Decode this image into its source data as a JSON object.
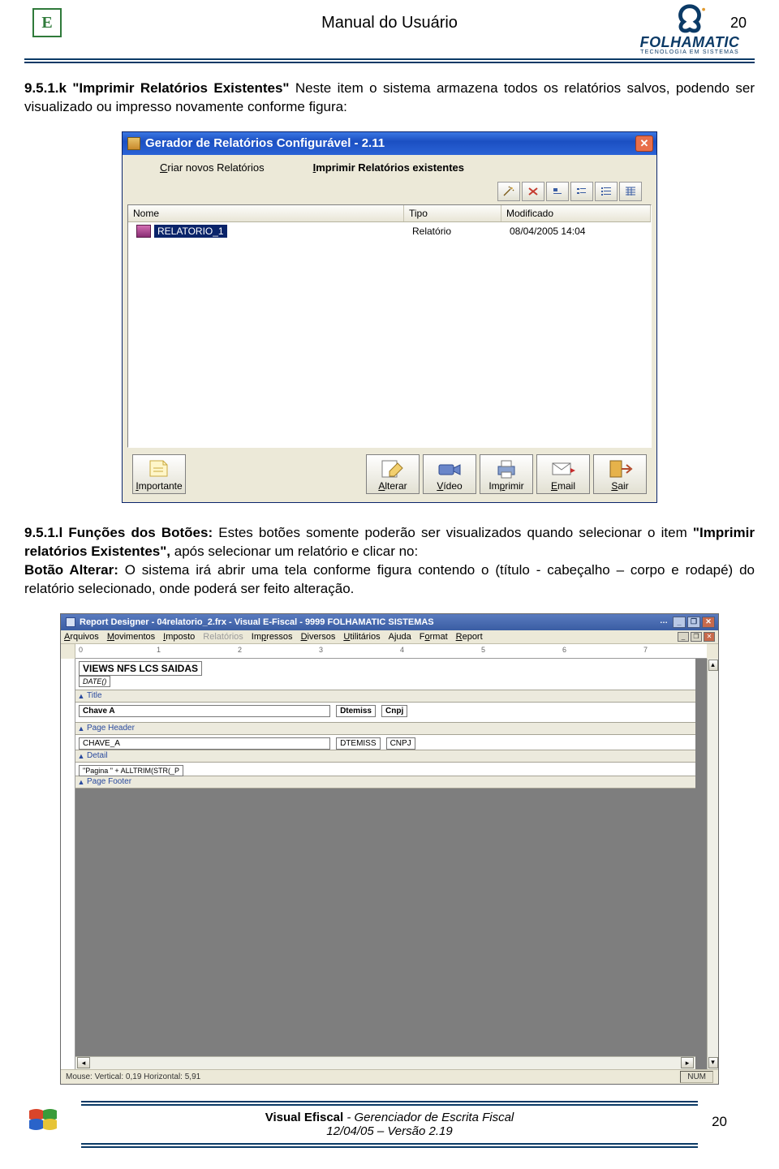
{
  "page": {
    "header_title": "Manual do Usuário",
    "page_number": "20"
  },
  "brand": {
    "name": "FOLHAMATIC",
    "tag": "TECNOLOGIA EM SISTEMAS"
  },
  "section_k": {
    "heading": "9.5.1.k \"Imprimir Relatórios Existentes\"",
    "text": " Neste item o sistema armazena todos os relatórios salvos, podendo ser visualizado ou impresso novamente conforme figura:"
  },
  "dialog": {
    "title": "Gerador de Relatórios Configurável  - 2.11",
    "menu": {
      "criar": "Criar novos Relatórios",
      "imprimir": "Imprimir Relatórios existentes"
    },
    "columns": {
      "name": "Nome",
      "type": "Tipo",
      "modified": "Modificado"
    },
    "rows": [
      {
        "name": "RELATORIO_1",
        "type": "Relatório",
        "modified": "08/04/2005 14:04"
      }
    ],
    "buttons": {
      "importante": "Importante",
      "alterar": "Alterar",
      "video": "Vídeo",
      "imprimir": "Imprimir",
      "email": "Email",
      "sair": "Sair"
    }
  },
  "section_l": {
    "heading": "9.5.1.l Funções dos Botões:",
    "text1": " Estes botões somente poderão ser visualizados quando selecionar o item ",
    "quote": "\"Imprimir relatórios Existentes\",",
    "text2": " após selecionar um relatório e clicar no:",
    "bullet_label": " Botão Alterar:",
    "bullet_text": " O sistema irá abrir uma tela conforme figura contendo o (título - cabeçalho – corpo e rodapé) do relatório selecionado, onde poderá ser feito alteração."
  },
  "report_designer": {
    "title": "Report Designer - 04relatorio_2.frx - Visual E-Fiscal   - 9999 FOLHAMATIC SISTEMAS",
    "menus": [
      "Arquivos",
      "Movimentos",
      "Imposto",
      "Relatórios",
      "Impressos",
      "Diversos",
      "Utilitários",
      "Ajuda",
      "Format",
      "Report"
    ],
    "ruler_marks": [
      "0",
      "1",
      "2",
      "3",
      "4",
      "5",
      "6",
      "7"
    ],
    "bands": {
      "title": "Title",
      "page_header": "Page Header",
      "detail": "Detail",
      "page_footer": "Page Footer"
    },
    "title_fields": {
      "view": "VIEWS NFS LCS SAIDAS",
      "date": "DATE()"
    },
    "header_fields": {
      "chave": "Chave A",
      "dtemiss": "Dtemiss",
      "cnpj": "Cnpj"
    },
    "detail_fields": {
      "chave": "CHAVE_A",
      "dtemiss": "DTEMISS",
      "cnpj": "CNPJ"
    },
    "footer_fields": {
      "pagina": "\"Pagina \" + ALLTRIM(STR(_P"
    },
    "status": {
      "mouse": "Mouse:  Vertical: 0,19   Horizontal: 5,91",
      "num": "NUM"
    }
  },
  "footer": {
    "product": "Visual Efiscal",
    "subtitle": " - Gerenciador de Escrita Fiscal",
    "line2": "12/04/05 – Versão 2.19",
    "page": "20"
  }
}
